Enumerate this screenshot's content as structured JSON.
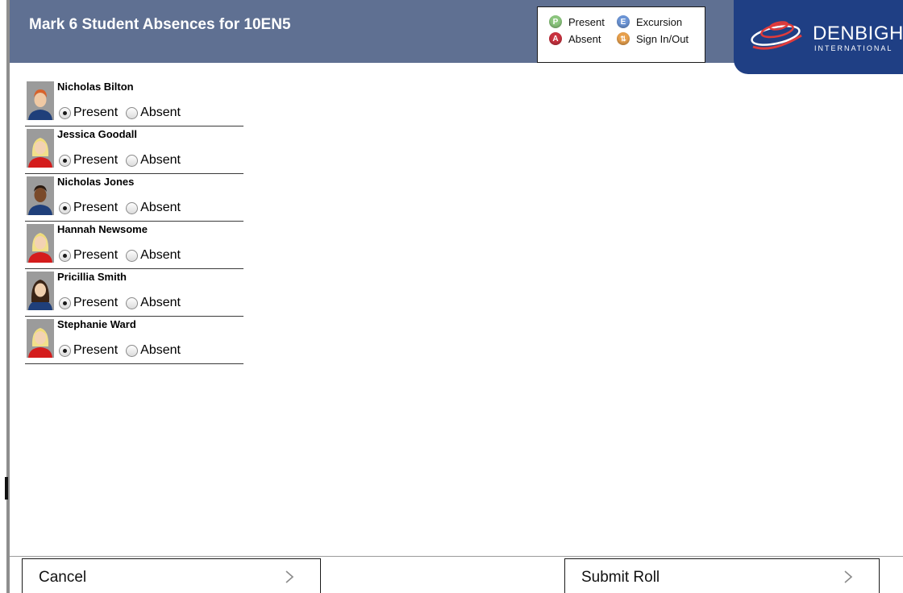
{
  "header": {
    "title": "Mark 6 Student Absences for 10EN5"
  },
  "legend": {
    "present": {
      "glyph": "P",
      "label": "Present",
      "color": "#8cc67e"
    },
    "excursion": {
      "glyph": "E",
      "label": "Excursion",
      "color": "#6c95d6"
    },
    "absent": {
      "glyph": "A",
      "label": "Absent",
      "color": "#c9323f"
    },
    "sign": {
      "glyph": "⇅",
      "label": "Sign In/Out",
      "color": "#e8a04c"
    }
  },
  "logo": {
    "name": "DENBIGH",
    "subtitle": "INTERNATIONAL",
    "background": "#1f3f84"
  },
  "students": [
    {
      "name": "Nicholas Bilton",
      "present_label": "Present",
      "absent_label": "Absent",
      "status": "present",
      "avatar": "red-haired-boy"
    },
    {
      "name": "Jessica Goodall",
      "present_label": "Present",
      "absent_label": "Absent",
      "status": "present",
      "avatar": "blonde-girl"
    },
    {
      "name": "Nicholas Jones",
      "present_label": "Present",
      "absent_label": "Absent",
      "status": "present",
      "avatar": "dark-skinned-boy"
    },
    {
      "name": "Hannah Newsome",
      "present_label": "Present",
      "absent_label": "Absent",
      "status": "present",
      "avatar": "blonde-girl"
    },
    {
      "name": "Pricillia Smith",
      "present_label": "Present",
      "absent_label": "Absent",
      "status": "present",
      "avatar": "brown-haired-girl"
    },
    {
      "name": "Stephanie Ward",
      "present_label": "Present",
      "absent_label": "Absent",
      "status": "present",
      "avatar": "blonde-girl"
    }
  ],
  "footer": {
    "cancel_label": "Cancel",
    "submit_label": "Submit Roll"
  }
}
